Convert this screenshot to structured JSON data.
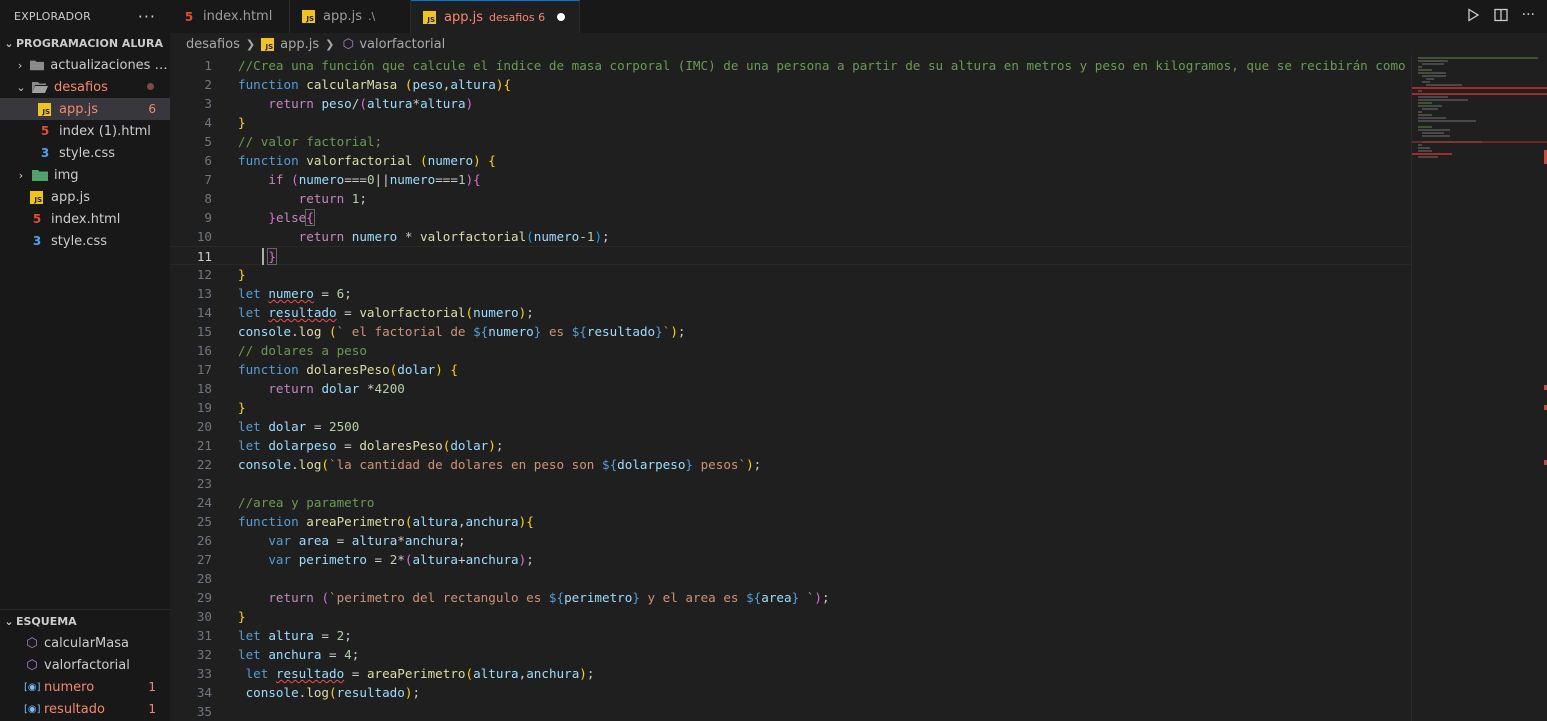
{
  "explorer": {
    "title": "EXPLORADOR",
    "more": "···",
    "project": "PROGRAMACION ALURA",
    "items": [
      {
        "label": "actualizaciones del..."
      },
      {
        "label": "desafios"
      },
      {
        "label": "app.js",
        "badge": "6"
      },
      {
        "label": "index (1).html"
      },
      {
        "label": "style.css"
      },
      {
        "label": "img"
      },
      {
        "label": "app.js"
      },
      {
        "label": "index.html"
      },
      {
        "label": "style.css"
      }
    ]
  },
  "outline": {
    "title": "ESQUEMA",
    "items": [
      {
        "label": "calcularMasa"
      },
      {
        "label": "valorfactorial"
      },
      {
        "label": "numero",
        "badge": "1"
      },
      {
        "label": "resultado",
        "badge": "1"
      }
    ]
  },
  "tabs": [
    {
      "label": "index.html"
    },
    {
      "label": "app.js",
      "desc": ".\\"
    },
    {
      "label": "app.js",
      "desc": "desafios 6"
    }
  ],
  "breadcrumb": [
    "desafios",
    "app.js",
    "valorfactorial"
  ],
  "editor": {
    "current_line": "11",
    "line_numbers": [
      "1",
      "2",
      "3",
      "4",
      "5",
      "6",
      "7",
      "8",
      "9",
      "10",
      "11",
      "12",
      "13",
      "14",
      "15",
      "16",
      "17",
      "18",
      "19",
      "20",
      "21",
      "22",
      "23",
      "24",
      "25",
      "26",
      "27",
      "28",
      "29",
      "30",
      "31",
      "32",
      "33",
      "34",
      "35"
    ],
    "lines": [
      "//Crea una función que calcule el índice de masa corporal (IMC) de una persona a partir de su altura en metros y peso en kilogramos, que se recibirán como parámetros.",
      "function calcularMasa (peso,altura){",
      "    return peso/(altura*altura)",
      "}",
      "// valor factorial;",
      "function valorfactorial (numero) {",
      "    if (numero===0||numero===1){",
      "        return 1;",
      "    }else{",
      "        return numero * valorfactorial(numero-1);",
      "    }",
      "}",
      "let numero = 6;",
      "let resultado = valorfactorial(numero);",
      "console.log (` el factorial de ${numero} es ${resultado}`);",
      "// dolares a peso",
      "function dolaresPeso(dolar) {",
      "    return dolar *4200",
      "}",
      "let dolar = 2500",
      "let dolarpeso = dolaresPeso(dolar);",
      "console.log(`la cantidad de dolares en peso son ${dolarpeso} pesos`);",
      "",
      "//area y parametro",
      "function areaPerimetro(altura,anchura){",
      "    var area = altura*anchura;",
      "    var perimetro = 2*(altura+anchura);",
      "",
      "    return (`perimetro del rectangulo es ${perimetro} y el area es ${area} `);",
      "}",
      "let altura = 2;",
      "let anchura = 4;",
      " let resultado = areaPerimetro(altura,anchura);",
      " console.log(resultado);",
      ""
    ]
  }
}
